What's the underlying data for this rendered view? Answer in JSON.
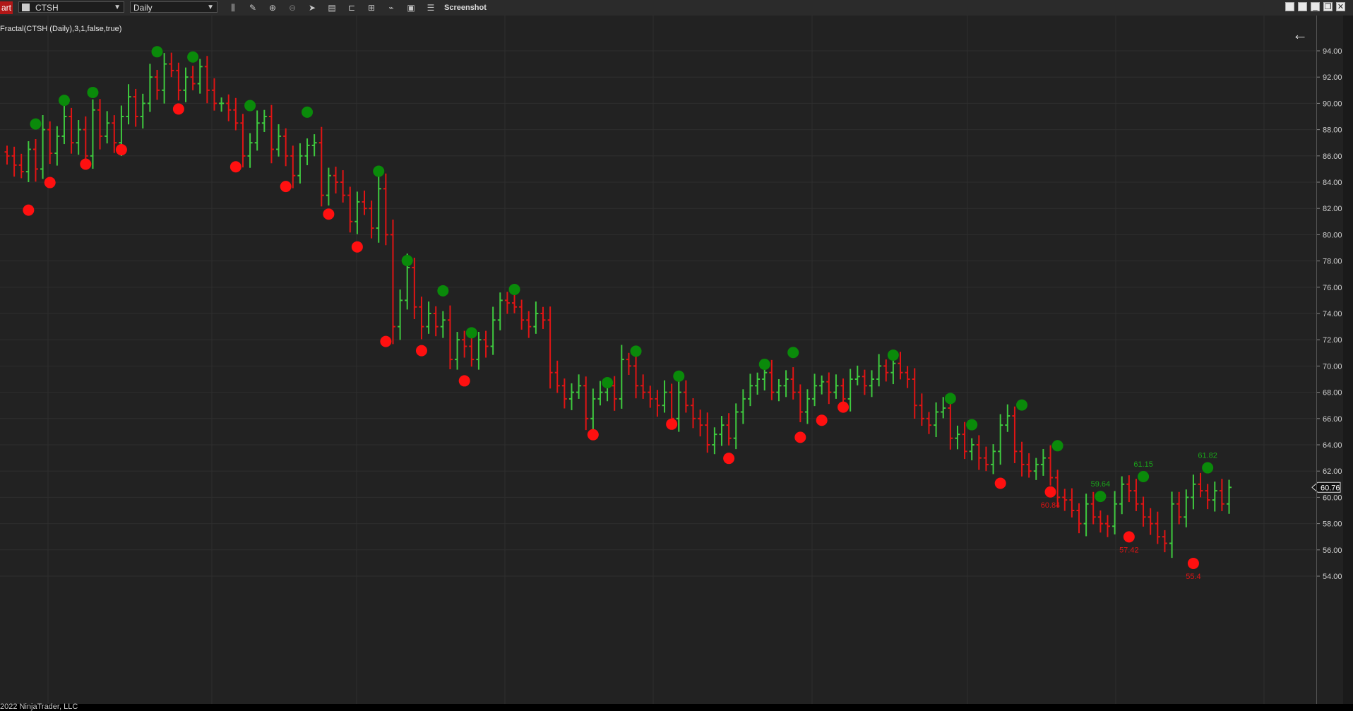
{
  "toolbar": {
    "tab_label": "art",
    "instrument": "CTSH",
    "interval": "Daily",
    "screenshot_label": "Screenshot",
    "icons": [
      "bar-type-icon",
      "drawing-tool-icon",
      "zoom-in-icon",
      "zoom-out-icon",
      "pointer-icon",
      "data-series-icon",
      "templates-icon",
      "strategies-icon",
      "indicators-icon",
      "properties-icon",
      "menu-icon"
    ],
    "window_buttons": [
      "tile-icon",
      "tile-icon",
      "minimize-icon",
      "restore-icon",
      "close-icon"
    ]
  },
  "indicator_label": "Fractal(CTSH (Daily),3,1,false,true)",
  "footer": "2022 NinjaTrader, LLC",
  "colors": {
    "background": "#222222",
    "up_bar": "#3ec93e",
    "down_bar": "#e01414",
    "fractal_high": "#0a8a0a",
    "fractal_low": "#ff1010",
    "grid": "#2e2e2e",
    "axis_text": "#d0d0d0"
  },
  "chart_data": {
    "type": "ohlc",
    "yaxis": {
      "min": 54,
      "max": 95,
      "ticks": [
        "94.00",
        "92.00",
        "90.00",
        "88.00",
        "86.00",
        "84.00",
        "82.00",
        "80.00",
        "78.00",
        "76.00",
        "74.00",
        "72.00",
        "70.00",
        "68.00",
        "66.00",
        "64.00",
        "62.00",
        "60.00",
        "58.00",
        "56.00",
        "54.00"
      ]
    },
    "last_price": "60.76",
    "closes": [
      86.0,
      85.3,
      84.8,
      86.5,
      85.0,
      88.0,
      86.2,
      87.5,
      89.0,
      87.0,
      88.0,
      86.0,
      89.5,
      87.5,
      88.5,
      87.0,
      89.0,
      90.5,
      89.0,
      90.0,
      92.0,
      91.0,
      93.0,
      92.5,
      91.0,
      92.0,
      91.5,
      92.8,
      91.0,
      90.0,
      90.0,
      89.5,
      88.5,
      86.0,
      87.0,
      88.5,
      89.0,
      86.5,
      87.5,
      86.0,
      84.5,
      86.0,
      86.8,
      87.0,
      83.0,
      84.5,
      84.0,
      83.0,
      81.0,
      82.5,
      82.0,
      80.5,
      83.5,
      80.0,
      73.0,
      75.0,
      77.5,
      74.5,
      73.0,
      74.0,
      73.0,
      73.5,
      70.5,
      72.0,
      71.5,
      70.5,
      72.0,
      71.5,
      73.5,
      75.0,
      74.8,
      74.5,
      73.5,
      73.0,
      74.0,
      73.5,
      69.5,
      68.5,
      67.5,
      68.0,
      68.5,
      66.0,
      67.5,
      68.0,
      68.5,
      67.5,
      70.5,
      70.0,
      68.5,
      68.0,
      67.5,
      67.0,
      68.0,
      66.0,
      68.0,
      67.0,
      66.0,
      65.5,
      64.0,
      64.8,
      65.5,
      64.5,
      66.5,
      67.5,
      68.5,
      69.0,
      69.5,
      68.0,
      68.5,
      69.0,
      68.0,
      66.5,
      67.5,
      68.5,
      68.8,
      68.0,
      68.5,
      67.5,
      69.0,
      69.2,
      68.5,
      69.0,
      70.0,
      69.5,
      70.2,
      69.5,
      69.0,
      67.0,
      66.0,
      65.5,
      66.5,
      66.8,
      64.5,
      64.8,
      63.5,
      64.0,
      63.0,
      62.5,
      63.5,
      65.5,
      66.2,
      63.5,
      62.5,
      62.0,
      62.5,
      63.0,
      61.5,
      60.0,
      59.8,
      59.0,
      58.0,
      59.5,
      58.5,
      58.0,
      57.8,
      59.5,
      61.0,
      60.5,
      59.5,
      58.5,
      58.0,
      57.0,
      56.5,
      59.5,
      58.5,
      60.0,
      61.0,
      60.5,
      59.8,
      60.5,
      59.5,
      60.76
    ],
    "fractal_highs": [
      {
        "bar": 4,
        "value": 88.0,
        "label": ""
      },
      {
        "bar": 8,
        "value": 89.8,
        "label": ""
      },
      {
        "bar": 12,
        "value": 90.4,
        "label": ""
      },
      {
        "bar": 21,
        "value": 93.5,
        "label": ""
      },
      {
        "bar": 26,
        "value": 93.1,
        "label": ""
      },
      {
        "bar": 34,
        "value": 89.4,
        "label": ""
      },
      {
        "bar": 42,
        "value": 88.9,
        "label": ""
      },
      {
        "bar": 52,
        "value": 84.4,
        "label": ""
      },
      {
        "bar": 56,
        "value": 77.6,
        "label": ""
      },
      {
        "bar": 61,
        "value": 75.3,
        "label": ""
      },
      {
        "bar": 65,
        "value": 72.1,
        "label": ""
      },
      {
        "bar": 71,
        "value": 75.4,
        "label": ""
      },
      {
        "bar": 84,
        "value": 68.3,
        "label": ""
      },
      {
        "bar": 88,
        "value": 70.7,
        "label": ""
      },
      {
        "bar": 94,
        "value": 68.8,
        "label": ""
      },
      {
        "bar": 106,
        "value": 69.7,
        "label": ""
      },
      {
        "bar": 110,
        "value": 70.6,
        "label": ""
      },
      {
        "bar": 124,
        "value": 70.4,
        "label": ""
      },
      {
        "bar": 132,
        "value": 67.1,
        "label": ""
      },
      {
        "bar": 135,
        "value": 65.1,
        "label": ""
      },
      {
        "bar": 142,
        "value": 66.6,
        "label": ""
      },
      {
        "bar": 147,
        "value": 63.5,
        "label": ""
      },
      {
        "bar": 153,
        "value": 59.64,
        "label": "59.64"
      },
      {
        "bar": 159,
        "value": 61.15,
        "label": "61.15"
      },
      {
        "bar": 168,
        "value": 61.82,
        "label": "61.82"
      }
    ],
    "fractal_lows": [
      {
        "bar": 3,
        "value": 82.3,
        "label": ""
      },
      {
        "bar": 6,
        "value": 84.4,
        "label": ""
      },
      {
        "bar": 11,
        "value": 85.8,
        "label": ""
      },
      {
        "bar": 16,
        "value": 86.9,
        "label": ""
      },
      {
        "bar": 24,
        "value": 90.0,
        "label": ""
      },
      {
        "bar": 32,
        "value": 85.6,
        "label": ""
      },
      {
        "bar": 39,
        "value": 84.1,
        "label": ""
      },
      {
        "bar": 45,
        "value": 82.0,
        "label": ""
      },
      {
        "bar": 49,
        "value": 79.5,
        "label": ""
      },
      {
        "bar": 53,
        "value": 72.3,
        "label": ""
      },
      {
        "bar": 58,
        "value": 71.6,
        "label": ""
      },
      {
        "bar": 64,
        "value": 69.3,
        "label": ""
      },
      {
        "bar": 82,
        "value": 65.2,
        "label": ""
      },
      {
        "bar": 93,
        "value": 66.0,
        "label": ""
      },
      {
        "bar": 101,
        "value": 63.4,
        "label": ""
      },
      {
        "bar": 111,
        "value": 65.0,
        "label": ""
      },
      {
        "bar": 114,
        "value": 66.3,
        "label": ""
      },
      {
        "bar": 117,
        "value": 67.3,
        "label": ""
      },
      {
        "bar": 139,
        "value": 61.5,
        "label": ""
      },
      {
        "bar": 146,
        "value": 60.84,
        "label": "60.84"
      },
      {
        "bar": 157,
        "value": 57.42,
        "label": "57.42"
      },
      {
        "bar": 166,
        "value": 55.4,
        "label": "55.4"
      }
    ]
  }
}
